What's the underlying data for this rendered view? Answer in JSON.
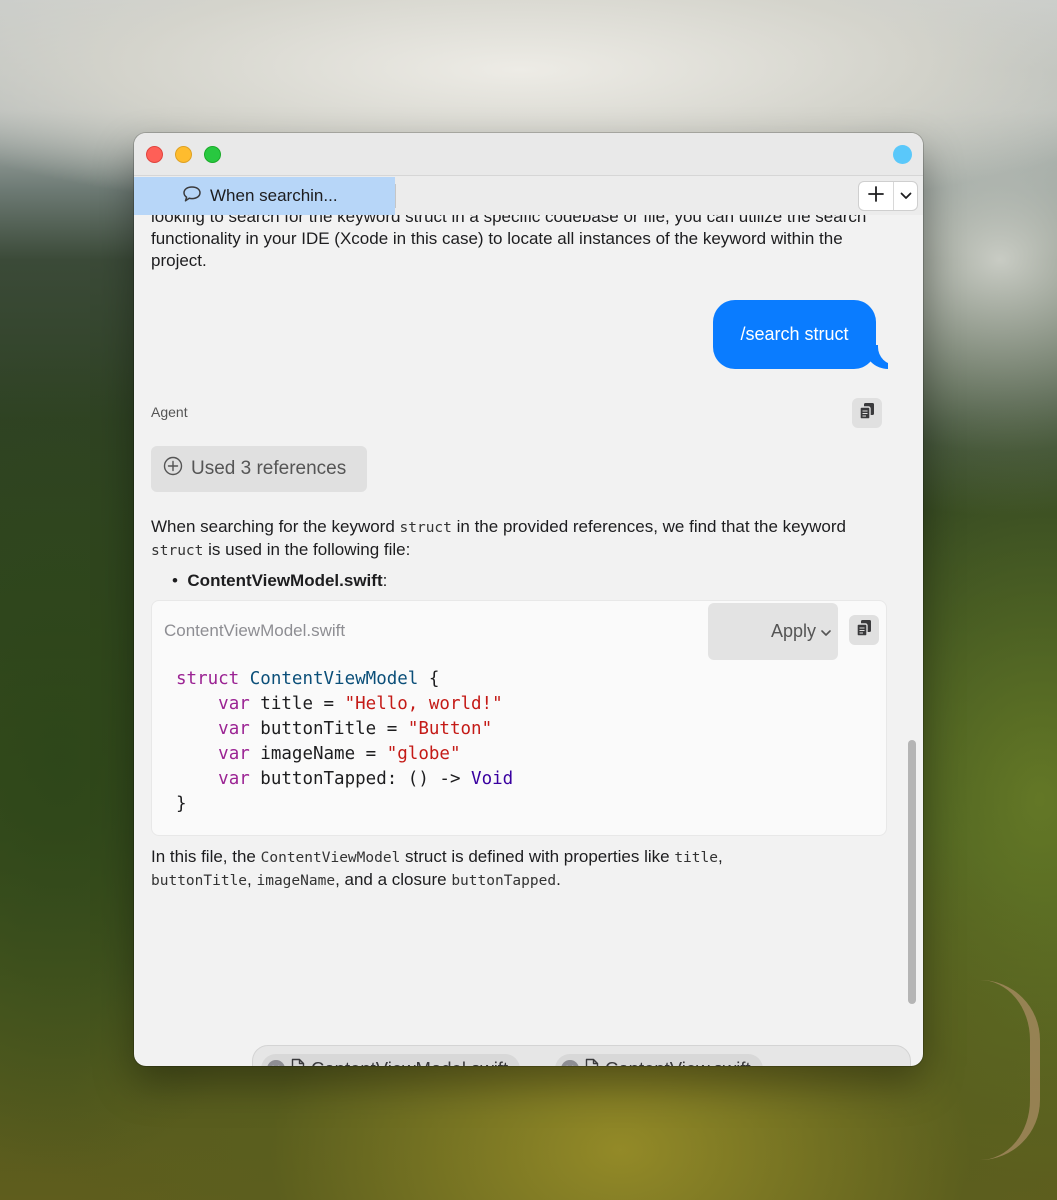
{
  "window": {
    "tab_title": "When searchin...",
    "colors": {
      "accent": "#0a7cff",
      "tab_active": "#b7d6f8",
      "status_dot": "#5ac8fa"
    }
  },
  "chat": {
    "intro_text": "looking to search for the keyword struct in a specific codebase or file, you can utilize the search functionality in your IDE (Xcode in this case) to locate all instances of the keyword within the project.",
    "user_message": "/search struct",
    "agent_label": "Agent",
    "references_label": "Used 3 references",
    "response_intro": {
      "a": "When searching for the keyword ",
      "b": "struct",
      "c": " in the provided references, we find that the keyword ",
      "d": "struct",
      "e": " is used in the following file:"
    },
    "bullet_file": "ContentViewModel.swift",
    "bullet_suffix": ":",
    "code_block": {
      "filename": "ContentViewModel.swift",
      "apply_label": "Apply",
      "lines": {
        "l1_kw": "struct",
        "l1_ty": "ContentViewModel",
        "l1_rest": " {",
        "l2_kw": "var",
        "l2_rest": " title = ",
        "l2_str": "\"Hello, world!\"",
        "l3_kw": "var",
        "l3_rest": " buttonTitle = ",
        "l3_str": "\"Button\"",
        "l4_kw": "var",
        "l4_rest": " imageName = ",
        "l4_str": "\"globe\"",
        "l5_kw": "var",
        "l5_rest": " buttonTapped: () -> ",
        "l5_ty": "Void",
        "l6": "}"
      }
    },
    "summary": {
      "a": "In this file, the ",
      "b": "ContentViewModel",
      "c": " struct is defined with properties like ",
      "d": "title",
      "e": ",",
      "f": "buttonTitle",
      "g": ", ",
      "h": "imageName",
      "i": ", and a closure ",
      "j": "buttonTapped",
      "k": "."
    }
  },
  "composer": {
    "attachments": [
      "ContentViewModel.swift",
      "ContentView.swift"
    ],
    "input_value": ""
  }
}
